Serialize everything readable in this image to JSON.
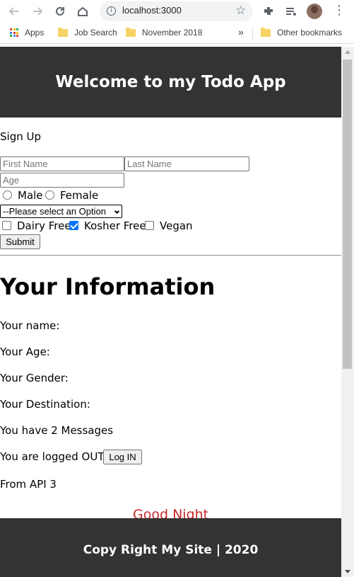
{
  "browser": {
    "url": "localhost:3000",
    "bookmarks": [
      "Apps",
      "Job Search",
      "November 2018"
    ],
    "overflow": "»",
    "other_bookmarks": "Other bookmarks"
  },
  "header": {
    "title": "Welcome to my Todo App"
  },
  "signup": {
    "label": "Sign Up",
    "first_name_placeholder": "First Name",
    "last_name_placeholder": "Last Name",
    "age_placeholder": "Age",
    "gender_options": [
      {
        "label": "Male",
        "selected": false
      },
      {
        "label": "Female",
        "selected": false
      }
    ],
    "destination_select": "--Please select an Option",
    "diet_options": [
      {
        "label": "Dairy Free",
        "checked": false
      },
      {
        "label": "Kosher Free",
        "checked": true
      },
      {
        "label": "Vegan",
        "checked": false
      }
    ],
    "submit_label": "Submit"
  },
  "info": {
    "title": "Your Information",
    "name_label": "Your name:",
    "age_label": "Your Age:",
    "gender_label": "Your Gender:",
    "destination_label": "Your Destination:",
    "messages_text": "You have 2 Messages",
    "logged_text": "You are logged OUT",
    "login_button": "Log IN",
    "api_text": "From API 3",
    "good_night": "Good Night"
  },
  "footer": {
    "text": "Copy Right My Site | 2020"
  },
  "colors": {
    "header_bg": "#333333",
    "accent_checkbox": "#0075ff",
    "good_night": "#c62828"
  }
}
